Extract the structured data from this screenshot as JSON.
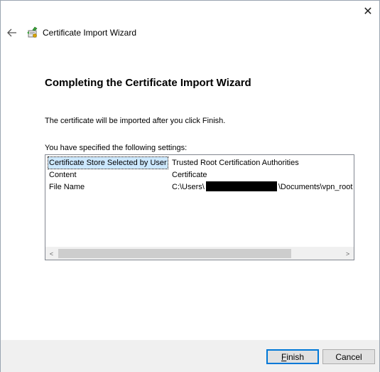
{
  "window": {
    "title": "Certificate Import Wizard",
    "close_label": "✕",
    "back_label": "←"
  },
  "main": {
    "heading": "Completing the Certificate Import Wizard",
    "info": "The certificate will be imported after you click Finish.",
    "settings_label": "You have specified the following settings:"
  },
  "settings": [
    {
      "name": "Certificate Store Selected by User",
      "value": "Trusted Root Certification Authorities"
    },
    {
      "name": "Content",
      "value": "Certificate"
    },
    {
      "name": "File Name",
      "value_prefix": "C:\\Users\\",
      "value_suffix": "\\Documents\\vpn_root"
    }
  ],
  "scrollbar": {
    "left_arrow": "<",
    "right_arrow": ">"
  },
  "buttons": {
    "finish_first": "F",
    "finish_rest": "inish",
    "cancel": "Cancel"
  }
}
